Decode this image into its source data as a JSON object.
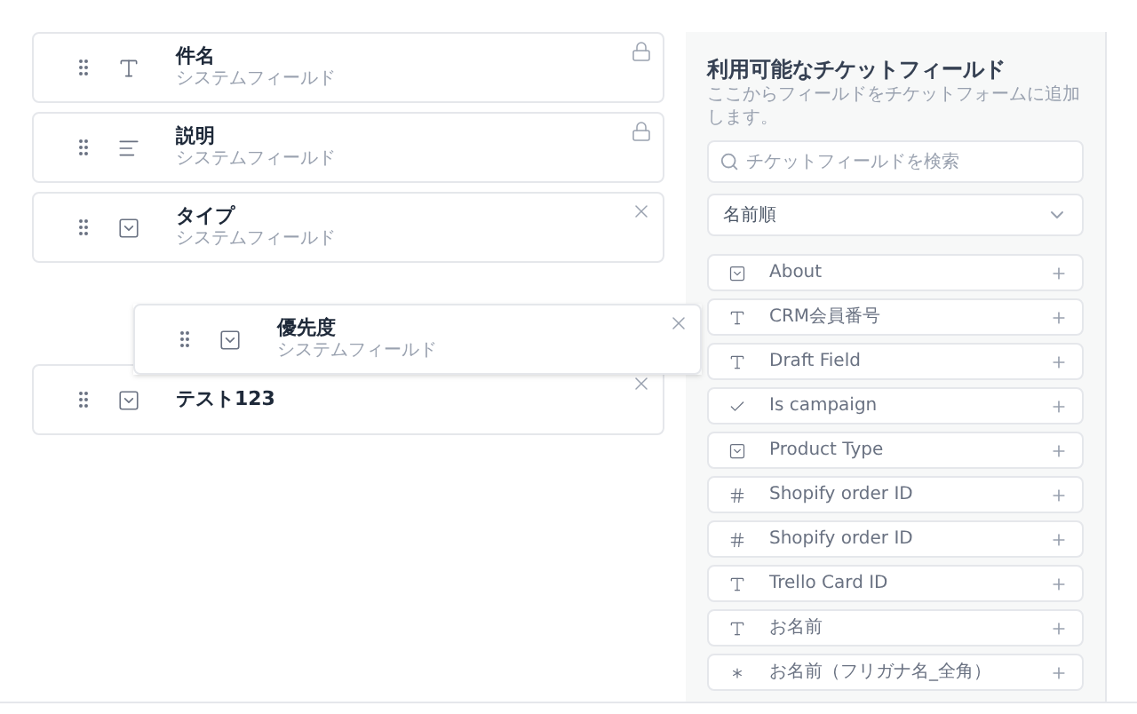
{
  "form_fields": [
    {
      "kind": "text",
      "title": "件名",
      "subtitle": "システムフィールド",
      "locked": true
    },
    {
      "kind": "textarea",
      "title": "説明",
      "subtitle": "システムフィールド",
      "locked": true
    },
    {
      "kind": "dropdown",
      "title": "タイプ",
      "subtitle": "システムフィールド",
      "locked": false
    },
    {
      "kind": "dropdown",
      "title": "テスト123",
      "locked": false
    }
  ],
  "dragged_field": {
    "kind": "dropdown",
    "title": "優先度",
    "subtitle": "システムフィールド",
    "locked": false
  },
  "available_panel": {
    "title": "利用可能なチケットフィールド",
    "subtitle": "ここからフィールドをチケットフォームに追加します。",
    "search": {
      "placeholder": "チケットフィールドを検索"
    },
    "sort": {
      "value": "名前順"
    },
    "items": [
      {
        "kind": "dropdown",
        "label": "About"
      },
      {
        "kind": "text",
        "label": "CRM会員番号"
      },
      {
        "kind": "text",
        "label": "Draft Field"
      },
      {
        "kind": "checkbox",
        "label": "Is campaign"
      },
      {
        "kind": "dropdown",
        "label": "Product Type"
      },
      {
        "kind": "number",
        "label": "Shopify order ID"
      },
      {
        "kind": "number",
        "label": "Shopify order ID"
      },
      {
        "kind": "text",
        "label": "Trello Card ID"
      },
      {
        "kind": "text",
        "label": "お名前"
      },
      {
        "kind": "multiselect",
        "label": "お名前（フリガナ名_全角）"
      }
    ]
  }
}
